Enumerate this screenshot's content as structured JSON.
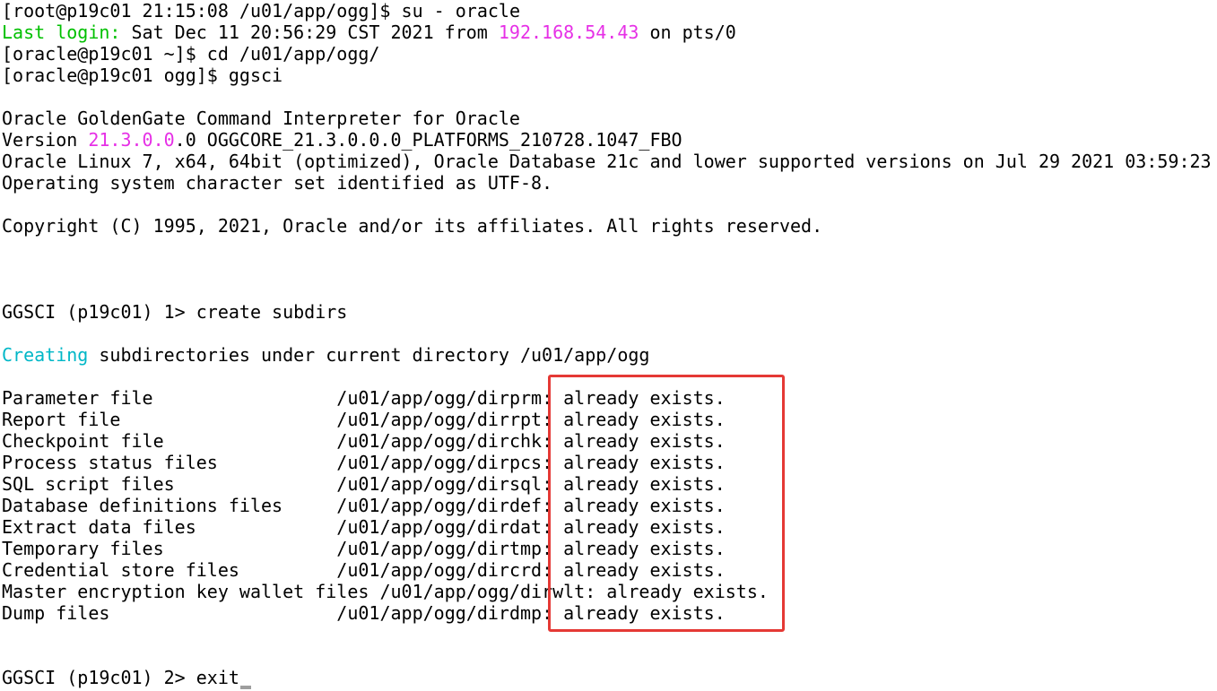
{
  "colors": {
    "background": "#ffffff",
    "text": "#000000",
    "green": "#00c000",
    "cyan": "#00b7c7",
    "magenta": "#e630e6",
    "highlight_box": "#e53935",
    "cursor": "#9e9e9e"
  },
  "terminal": {
    "su_prompt": "[root@p19c01 21:15:08 /u01/app/ogg]$ ",
    "su_command": "su - oracle",
    "last_login_label": "Last login:",
    "last_login_date": " Sat Dec 11 20:56:29 CST 2021 from ",
    "last_login_ip": "192.168.54.43",
    "last_login_tail": " on pts/0",
    "cd_prompt": "[oracle@p19c01 ~]$ ",
    "cd_command": "cd /u01/app/ogg/",
    "ggsci_prompt": "[oracle@p19c01 ogg]$ ",
    "ggsci_command": "ggsci",
    "banner_title": "Oracle GoldenGate Command Interpreter for Oracle",
    "version_label": "Version ",
    "version_number": "21.3.0.0",
    "version_rest": ".0 OGGCORE_21.3.0.0.0_PLATFORMS_210728.1047_FBO",
    "platform_line": "Oracle Linux 7, x64, 64bit (optimized), Oracle Database 21c and lower supported versions on Jul 29 2021 03:59:23",
    "charset_line": "Operating system character set identified as UTF-8.",
    "copyright_line": "Copyright (C) 1995, 2021, Oracle and/or its affiliates. All rights reserved.",
    "prompt1": "GGSCI (p19c01) 1> ",
    "command1": "create subdirs",
    "creating_word": "Creating",
    "creating_rest": " subdirectories under current directory /u01/app/ogg",
    "subdirs": [
      {
        "label": "Parameter file                 ",
        "path": "/u01/app/ogg/dirprm",
        "status": ": already exists."
      },
      {
        "label": "Report file                    ",
        "path": "/u01/app/ogg/dirrpt",
        "status": ": already exists."
      },
      {
        "label": "Checkpoint file                ",
        "path": "/u01/app/ogg/dirchk",
        "status": ": already exists."
      },
      {
        "label": "Process status files           ",
        "path": "/u01/app/ogg/dirpcs",
        "status": ": already exists."
      },
      {
        "label": "SQL script files               ",
        "path": "/u01/app/ogg/dirsql",
        "status": ": already exists."
      },
      {
        "label": "Database definitions files     ",
        "path": "/u01/app/ogg/dirdef",
        "status": ": already exists."
      },
      {
        "label": "Extract data files             ",
        "path": "/u01/app/ogg/dirdat",
        "status": ": already exists."
      },
      {
        "label": "Temporary files                ",
        "path": "/u01/app/ogg/dirtmp",
        "status": ": already exists."
      },
      {
        "label": "Credential store files         ",
        "path": "/u01/app/ogg/dircrd",
        "status": ": already exists."
      },
      {
        "label": "Master encryption key wallet files ",
        "path": "/u01/app/ogg/dirwlt",
        "status": ": already exists."
      },
      {
        "label": "Dump files                     ",
        "path": "/u01/app/ogg/dirdmp",
        "status": ": already exists."
      }
    ],
    "prompt2": "GGSCI (p19c01) 2> ",
    "command2": "exit"
  }
}
